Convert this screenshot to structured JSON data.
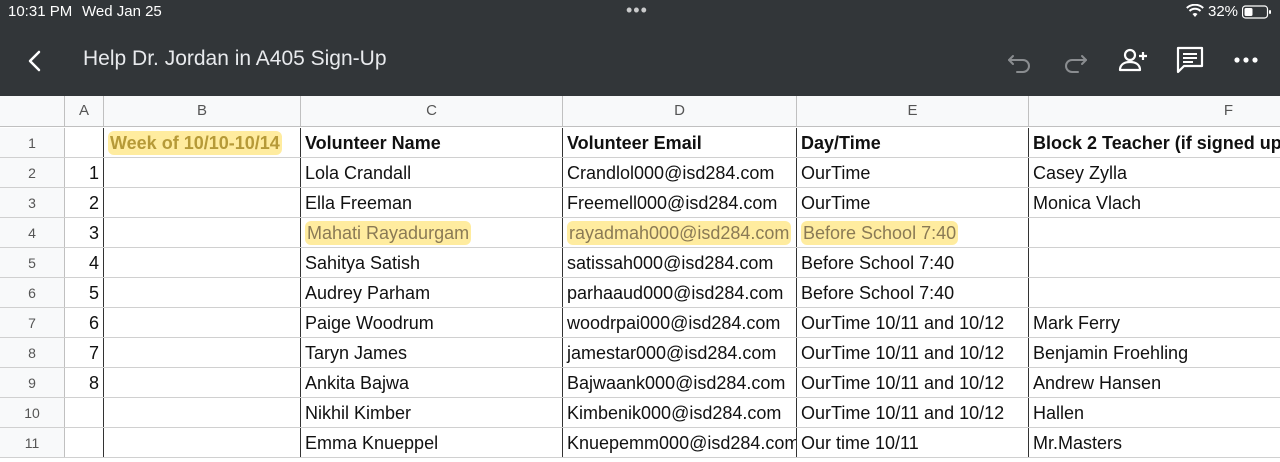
{
  "status": {
    "time": "10:31 PM",
    "date": "Wed Jan 25",
    "dots": "•••",
    "battery_pct": "32%"
  },
  "toolbar": {
    "title": "Help Dr. Jordan in A405 Sign-Up",
    "icons": [
      "back-icon",
      "undo-icon",
      "redo-icon",
      "add-person-icon",
      "comment-icon",
      "more-icon"
    ]
  },
  "sheet": {
    "columns": [
      "A",
      "B",
      "C",
      "D",
      "E",
      "F"
    ],
    "rows": [
      {
        "num": "1",
        "a": "",
        "b": "Week of 10/10-10/14",
        "c": "Volunteer Name",
        "d": "Volunteer Email",
        "e": "Day/Time",
        "f": "Block 2 Teacher (if signed up"
      },
      {
        "num": "2",
        "a": "1",
        "b": "",
        "c": "Lola Crandall",
        "d": "Crandlol000@isd284.com",
        "e": "OurTime",
        "f": "Casey Zylla"
      },
      {
        "num": "3",
        "a": "2",
        "b": "",
        "c": "Ella Freeman",
        "d": "Freemell000@isd284.com",
        "e": "OurTime",
        "f": "Monica Vlach"
      },
      {
        "num": "4",
        "a": "3",
        "b": "",
        "c": "Mahati Rayadurgam",
        "d": "rayadmah000@isd284.com",
        "e": "Before School 7:40",
        "f": ""
      },
      {
        "num": "5",
        "a": "4",
        "b": "",
        "c": "Sahitya Satish",
        "d": "satissah000@isd284.com",
        "e": "Before School 7:40",
        "f": ""
      },
      {
        "num": "6",
        "a": "5",
        "b": "",
        "c": "Audrey Parham",
        "d": "parhaaud000@isd284.com",
        "e": "Before School 7:40",
        "f": ""
      },
      {
        "num": "7",
        "a": "6",
        "b": "",
        "c": "Paige Woodrum",
        "d": "woodrpai000@isd284.com",
        "e": "OurTime 10/11 and 10/12",
        "f": "Mark Ferry"
      },
      {
        "num": "8",
        "a": "7",
        "b": "",
        "c": "Taryn James",
        "d": "jamestar000@isd284.com",
        "e": "OurTime 10/11 and 10/12",
        "f": "Benjamin Froehling"
      },
      {
        "num": "9",
        "a": "8",
        "b": "",
        "c": "Ankita Bajwa",
        "d": "Bajwaank000@isd284.com",
        "e": "OurTime 10/11 and 10/12",
        "f": "Andrew Hansen"
      },
      {
        "num": "10",
        "a": "",
        "b": "",
        "c": "Nikhil Kimber",
        "d": "Kimbenik000@isd284.com",
        "e": "OurTime 10/11 and 10/12",
        "f": "Hallen"
      },
      {
        "num": "11",
        "a": "",
        "b": "",
        "c": "Emma Knueppel",
        "d": "Knuepemm000@isd284.com",
        "e": "Our time 10/11",
        "f": "Mr.Masters"
      }
    ]
  }
}
